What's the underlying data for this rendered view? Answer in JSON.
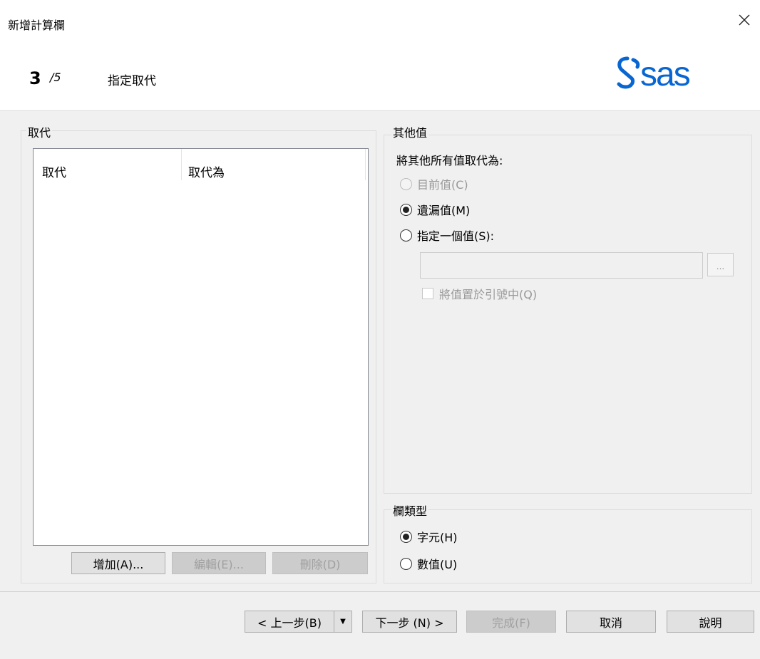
{
  "window": {
    "title": "新增計算欄"
  },
  "wizard": {
    "step_current": "3",
    "step_total": "/5",
    "step_name": "指定取代"
  },
  "replace_group": {
    "label": "取代",
    "columns": [
      "取代",
      "取代為"
    ],
    "buttons": {
      "add": "增加(A)...",
      "edit": "編輯(E)...",
      "delete": "刪除(D)"
    }
  },
  "other_values_group": {
    "label": "其他值",
    "prompt": "將其他所有值取代為:",
    "options": [
      {
        "label": "目前值(C)",
        "checked": false,
        "disabled": true
      },
      {
        "label": "遺漏值(M)",
        "checked": true,
        "disabled": false
      },
      {
        "label": "指定一個值(S):",
        "checked": false,
        "disabled": false
      }
    ],
    "value": "",
    "browse_label": "...",
    "quote_checkbox": {
      "label": "將值置於引號中(Q)",
      "checked": false
    }
  },
  "column_type_group": {
    "label": "欄類型",
    "options": [
      {
        "label": "字元(H)",
        "checked": true
      },
      {
        "label": "數值(U)",
        "checked": false
      }
    ]
  },
  "footer": {
    "back": "< 上一步(B)",
    "next": "下一步 (N) >",
    "finish": "完成(F)",
    "cancel": "取消",
    "help": "說明"
  },
  "logo": {
    "text": "sas",
    "color": "#0766d1"
  }
}
